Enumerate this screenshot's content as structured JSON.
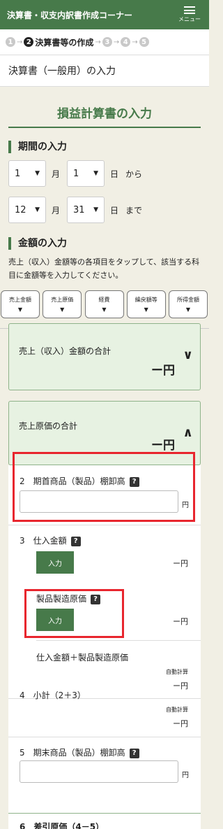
{
  "header": {
    "title": "決算書・収支内訳書作成コーナー",
    "menu_label": "メニュー"
  },
  "steps": {
    "items": [
      "1",
      "2",
      "3",
      "4",
      "5"
    ],
    "active_label": "決算書等の作成"
  },
  "page_title": "決算書（一般用）の入力",
  "section_title": "損益計算書の入力",
  "period": {
    "heading": "期間の入力",
    "from": {
      "month": "1",
      "day": "1",
      "month_unit": "月",
      "day_unit": "日",
      "suffix": "から"
    },
    "to": {
      "month": "12",
      "day": "31",
      "month_unit": "月",
      "day_unit": "日",
      "suffix": "まで"
    }
  },
  "amount": {
    "heading": "金額の入力",
    "instruction": "売上（収入）金額等の各項目をタップして、該当する科目に金額等を入力してください。",
    "categories": [
      "売上金額",
      "売上原価",
      "経費",
      "繰戻額等",
      "所得金額"
    ]
  },
  "accordions": {
    "sales": {
      "title": "売上（収入）金額の合計",
      "amount": "ー円"
    },
    "cogs": {
      "title": "売上原価の合計",
      "amount": "ー円"
    }
  },
  "rows": {
    "opening_inventory": {
      "number": "2",
      "title": "期首商品（製品）棚卸高",
      "value": "",
      "unit": "円"
    },
    "purchases": {
      "number": "3",
      "title": "仕入金額",
      "button": "入力",
      "amount": "ー円"
    },
    "manufacturing": {
      "title": "製品製造原価",
      "button": "入力",
      "amount": "ー円"
    },
    "purchase_sum": {
      "title": "仕入金額＋製品製造原価",
      "auto_label": "自動計算",
      "amount": "ー円"
    },
    "subtotal": {
      "number": "4",
      "title": "小計（2＋3）",
      "auto_label": "自動計算",
      "amount": "ー円"
    },
    "closing_inventory": {
      "number": "5",
      "title": "期末商品（製品）棚卸高",
      "value": "",
      "unit": "円"
    },
    "cost_diff": {
      "number": "6",
      "title": "差引原価（4－5）"
    }
  },
  "help_symbol": "?",
  "caret_symbol": "▼",
  "colors": {
    "brand": "#477a4a",
    "highlight": "#e8262e",
    "panel": "#e7f2e2"
  }
}
